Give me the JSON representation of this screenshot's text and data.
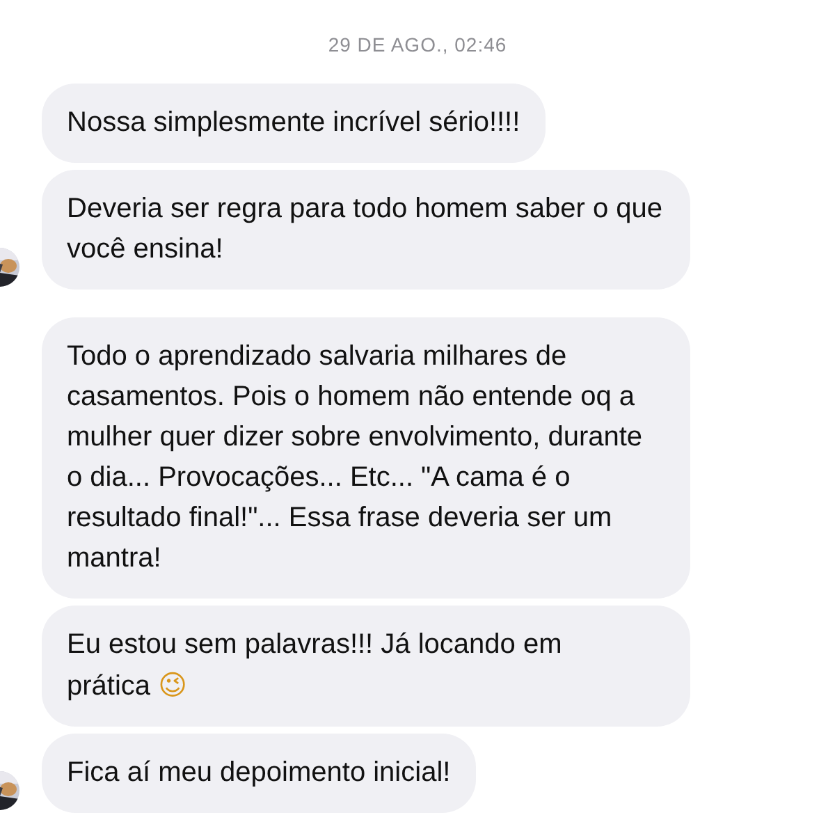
{
  "timestamp": "29 DE AGO., 02:46",
  "messages": [
    {
      "text": "Nossa simplesmente incrível sério!!!!",
      "avatar": false
    },
    {
      "text": "Deveria ser regra para todo homem saber o que você ensina!",
      "avatar": true
    },
    {
      "text": "Todo o aprendizado salvaria milhares de casamentos. Pois o homem não entende oq a mulher quer dizer sobre envolvimento, durante o dia... Provocações... Etc... \"A cama é o resultado final!\"... Essa frase deveria ser um mantra!",
      "avatar": false
    },
    {
      "text": "Eu estou sem palavras!!! Já locando em prática",
      "emoji": "😉",
      "avatar": false
    },
    {
      "text": "Fica aí meu depoimento inicial!",
      "avatar": true
    }
  ]
}
